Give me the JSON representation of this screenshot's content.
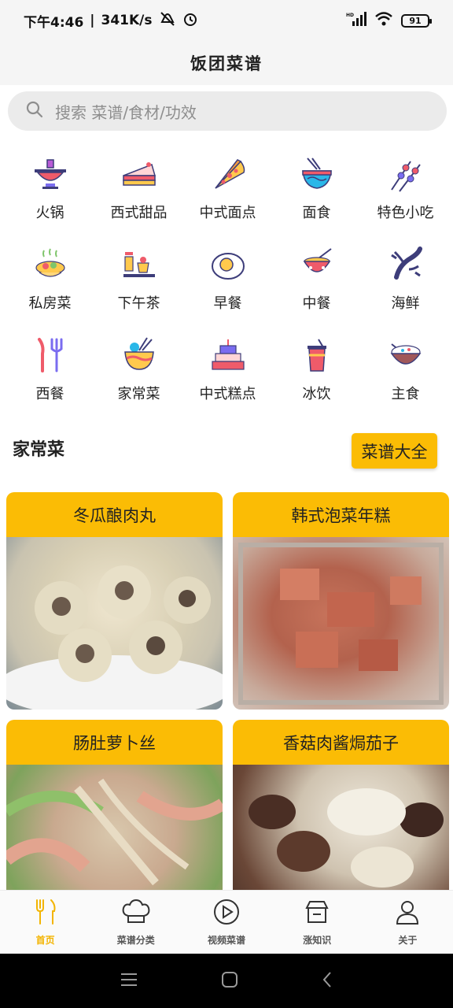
{
  "status_bar": {
    "time": "下午4:46",
    "speed": "341K/s",
    "battery": "91",
    "network_label": "HD"
  },
  "header": {
    "title": "饭团菜谱"
  },
  "search": {
    "placeholder": "搜索 菜谱/食材/功效"
  },
  "categories": [
    {
      "label": "火锅",
      "icon": "hotpot-icon"
    },
    {
      "label": "西式甜品",
      "icon": "cake-slice-icon"
    },
    {
      "label": "中式面点",
      "icon": "pizza-icon"
    },
    {
      "label": "面食",
      "icon": "noodle-bowl-icon"
    },
    {
      "label": "特色小吃",
      "icon": "skewer-icon"
    },
    {
      "label": "私房菜",
      "icon": "dish-icon"
    },
    {
      "label": "下午茶",
      "icon": "afternoon-tea-icon"
    },
    {
      "label": "早餐",
      "icon": "fried-egg-icon"
    },
    {
      "label": "中餐",
      "icon": "rice-bowl-chopsticks-icon"
    },
    {
      "label": "海鲜",
      "icon": "lobster-icon"
    },
    {
      "label": "西餐",
      "icon": "fork-knife-icon"
    },
    {
      "label": "家常菜",
      "icon": "bowl-chopsticks-icon"
    },
    {
      "label": "中式糕点",
      "icon": "layer-cake-icon"
    },
    {
      "label": "冰饮",
      "icon": "iced-drink-icon"
    },
    {
      "label": "主食",
      "icon": "rice-bowl-icon"
    }
  ],
  "section": {
    "title": "家常菜",
    "all_button": "菜谱大全"
  },
  "recipes": [
    {
      "title": "冬瓜酿肉丸"
    },
    {
      "title": "韩式泡菜年糕"
    },
    {
      "title": "肠肚萝卜丝"
    },
    {
      "title": "香菇肉酱焗茄子"
    }
  ],
  "bottom_nav": [
    {
      "label": "首页",
      "icon": "fork-spoon-icon",
      "active": true
    },
    {
      "label": "菜谱分类",
      "icon": "chef-hat-icon",
      "active": false
    },
    {
      "label": "视频菜谱",
      "icon": "play-icon",
      "active": false
    },
    {
      "label": "涨知识",
      "icon": "store-icon",
      "active": false
    },
    {
      "label": "关于",
      "icon": "user-icon",
      "active": false
    }
  ],
  "colors": {
    "accent": "#fbbc05",
    "active_nav": "#f3b400",
    "search_bg": "#ebebeb",
    "header_bg": "#f5f5f5"
  }
}
